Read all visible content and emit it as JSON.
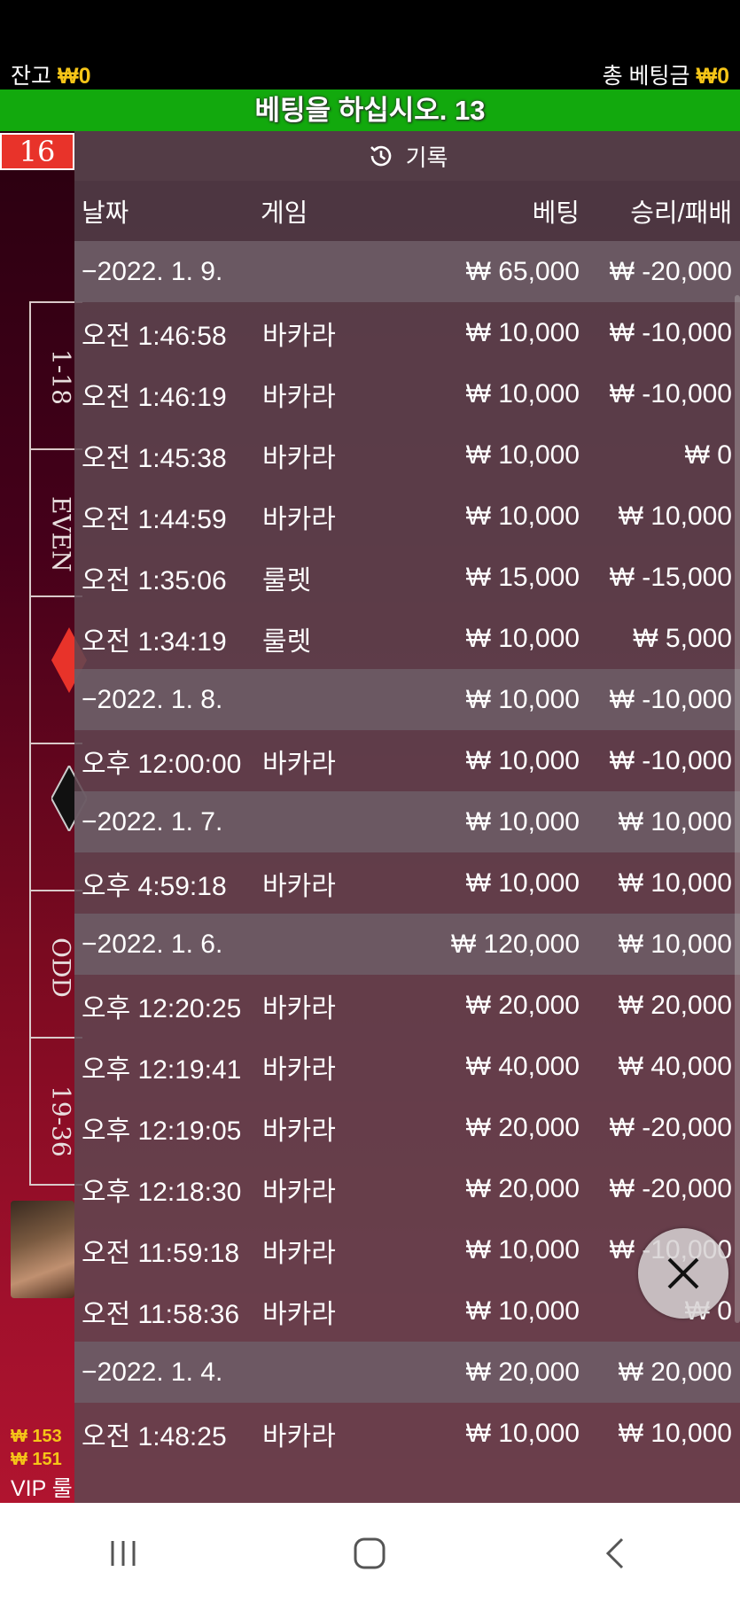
{
  "status": {
    "balance_label": "잔고",
    "balance_value": "₩0",
    "total_bet_label": "총 베팅금",
    "total_bet_value": "₩0"
  },
  "banner": {
    "text": "베팅을 하십시오. 13"
  },
  "table": {
    "last_number": "16",
    "side_labels": [
      "1-18",
      "EVEN",
      "",
      "",
      "ODD",
      "19-36"
    ],
    "diamond_colors": [
      "#e8332a",
      "#111111"
    ],
    "vip_label": "VIP 룰",
    "jackpot_values": [
      "₩ 153",
      "₩ 151"
    ]
  },
  "history": {
    "title": "기록",
    "columns": {
      "date": "날짜",
      "game": "게임",
      "bet": "베팅",
      "result": "승리/패배"
    },
    "rows": [
      {
        "type": "group",
        "date": "−2022. 1. 9.",
        "game": "",
        "bet": "₩ 65,000",
        "result": "₩ -20,000"
      },
      {
        "type": "item",
        "date": "오전 1:46:58",
        "game": "바카라",
        "bet": "₩ 10,000",
        "result": "₩ -10,000"
      },
      {
        "type": "item",
        "date": "오전 1:46:19",
        "game": "바카라",
        "bet": "₩ 10,000",
        "result": "₩ -10,000"
      },
      {
        "type": "item",
        "date": "오전 1:45:38",
        "game": "바카라",
        "bet": "₩ 10,000",
        "result": "₩ 0"
      },
      {
        "type": "item",
        "date": "오전 1:44:59",
        "game": "바카라",
        "bet": "₩ 10,000",
        "result": "₩ 10,000"
      },
      {
        "type": "item",
        "date": "오전 1:35:06",
        "game": "룰렛",
        "bet": "₩ 15,000",
        "result": "₩ -15,000"
      },
      {
        "type": "item",
        "date": "오전 1:34:19",
        "game": "룰렛",
        "bet": "₩ 10,000",
        "result": "₩ 5,000"
      },
      {
        "type": "group",
        "date": "−2022. 1. 8.",
        "game": "",
        "bet": "₩ 10,000",
        "result": "₩ -10,000"
      },
      {
        "type": "item",
        "date": "오후 12:00:00",
        "game": "바카라",
        "bet": "₩ 10,000",
        "result": "₩ -10,000"
      },
      {
        "type": "group",
        "date": "−2022. 1. 7.",
        "game": "",
        "bet": "₩ 10,000",
        "result": "₩ 10,000"
      },
      {
        "type": "item",
        "date": "오후 4:59:18",
        "game": "바카라",
        "bet": "₩ 10,000",
        "result": "₩ 10,000"
      },
      {
        "type": "group",
        "date": "−2022. 1. 6.",
        "game": "",
        "bet": "₩ 120,000",
        "result": "₩ 10,000"
      },
      {
        "type": "item",
        "date": "오후 12:20:25",
        "game": "바카라",
        "bet": "₩ 20,000",
        "result": "₩ 20,000"
      },
      {
        "type": "item",
        "date": "오후 12:19:41",
        "game": "바카라",
        "bet": "₩ 40,000",
        "result": "₩ 40,000"
      },
      {
        "type": "item",
        "date": "오후 12:19:05",
        "game": "바카라",
        "bet": "₩ 20,000",
        "result": "₩ -20,000"
      },
      {
        "type": "item",
        "date": "오후 12:18:30",
        "game": "바카라",
        "bet": "₩ 20,000",
        "result": "₩ -20,000"
      },
      {
        "type": "item",
        "date": "오전 11:59:18",
        "game": "바카라",
        "bet": "₩ 10,000",
        "result": "₩ -10,000"
      },
      {
        "type": "item",
        "date": "오전 11:58:36",
        "game": "바카라",
        "bet": "₩ 10,000",
        "result": "₩ 0"
      },
      {
        "type": "group",
        "date": "−2022. 1. 4.",
        "game": "",
        "bet": "₩ 20,000",
        "result": "₩ 20,000"
      },
      {
        "type": "item",
        "date": "오전 1:48:25",
        "game": "바카라",
        "bet": "₩ 10,000",
        "result": "₩ 10,000"
      }
    ]
  },
  "icons": {
    "history": "history-clock-icon",
    "close": "close-icon",
    "nav_recents": "recents-icon",
    "nav_home": "home-icon",
    "nav_back": "back-icon"
  }
}
